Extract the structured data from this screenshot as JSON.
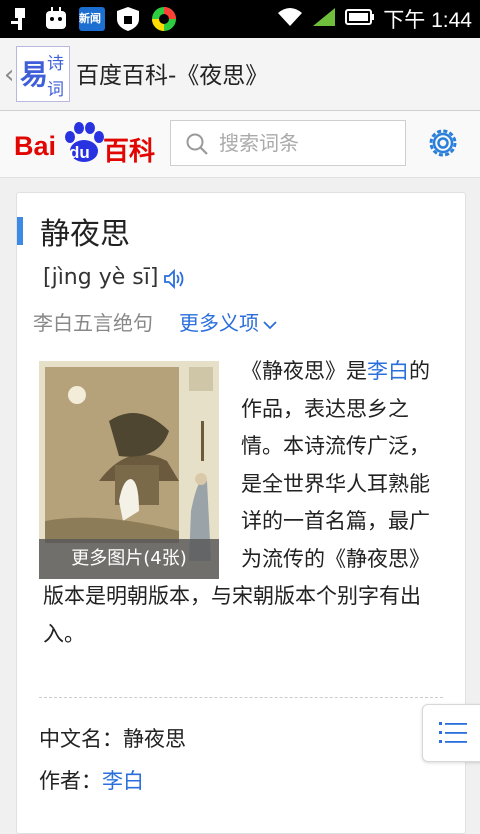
{
  "status_bar": {
    "time": "下午 1:44",
    "left_icons": [
      "usb-icon",
      "android-robot-icon",
      "news-app-icon",
      "security-shield-icon",
      "sync-app-icon"
    ],
    "news_label": "新闻"
  },
  "app_bar": {
    "title": "百度百科-《夜思》",
    "logo_chars": [
      "易",
      "诗",
      "词"
    ]
  },
  "baidu_header": {
    "logo": {
      "bai": "Bai",
      "du": "du",
      "baike": "百科"
    },
    "search_placeholder": "搜索词条"
  },
  "entry": {
    "title": "静夜思",
    "pinyin": "[jìng yè sī]",
    "subtitle": "李白五言绝句",
    "more_meanings": "更多义项",
    "image_caption": "更多图片(4张)",
    "summary": {
      "part1": "《静夜思》是",
      "link": "李白",
      "part2": "的作品，表达思乡之情。本诗流传广泛，是全世界华人耳熟能详的一首名篇，最广为流传的《静夜思》版本是明朝版本，与宋朝版本个别字有出入。"
    },
    "info": [
      {
        "label": "中文名：",
        "value": "静夜思",
        "is_link": false
      },
      {
        "label": "作者：",
        "value": "李白",
        "is_link": true
      }
    ]
  },
  "colors": {
    "accent_blue": "#2a6fdb",
    "baidu_red": "#e10601",
    "baidu_blue": "#2932e1"
  }
}
